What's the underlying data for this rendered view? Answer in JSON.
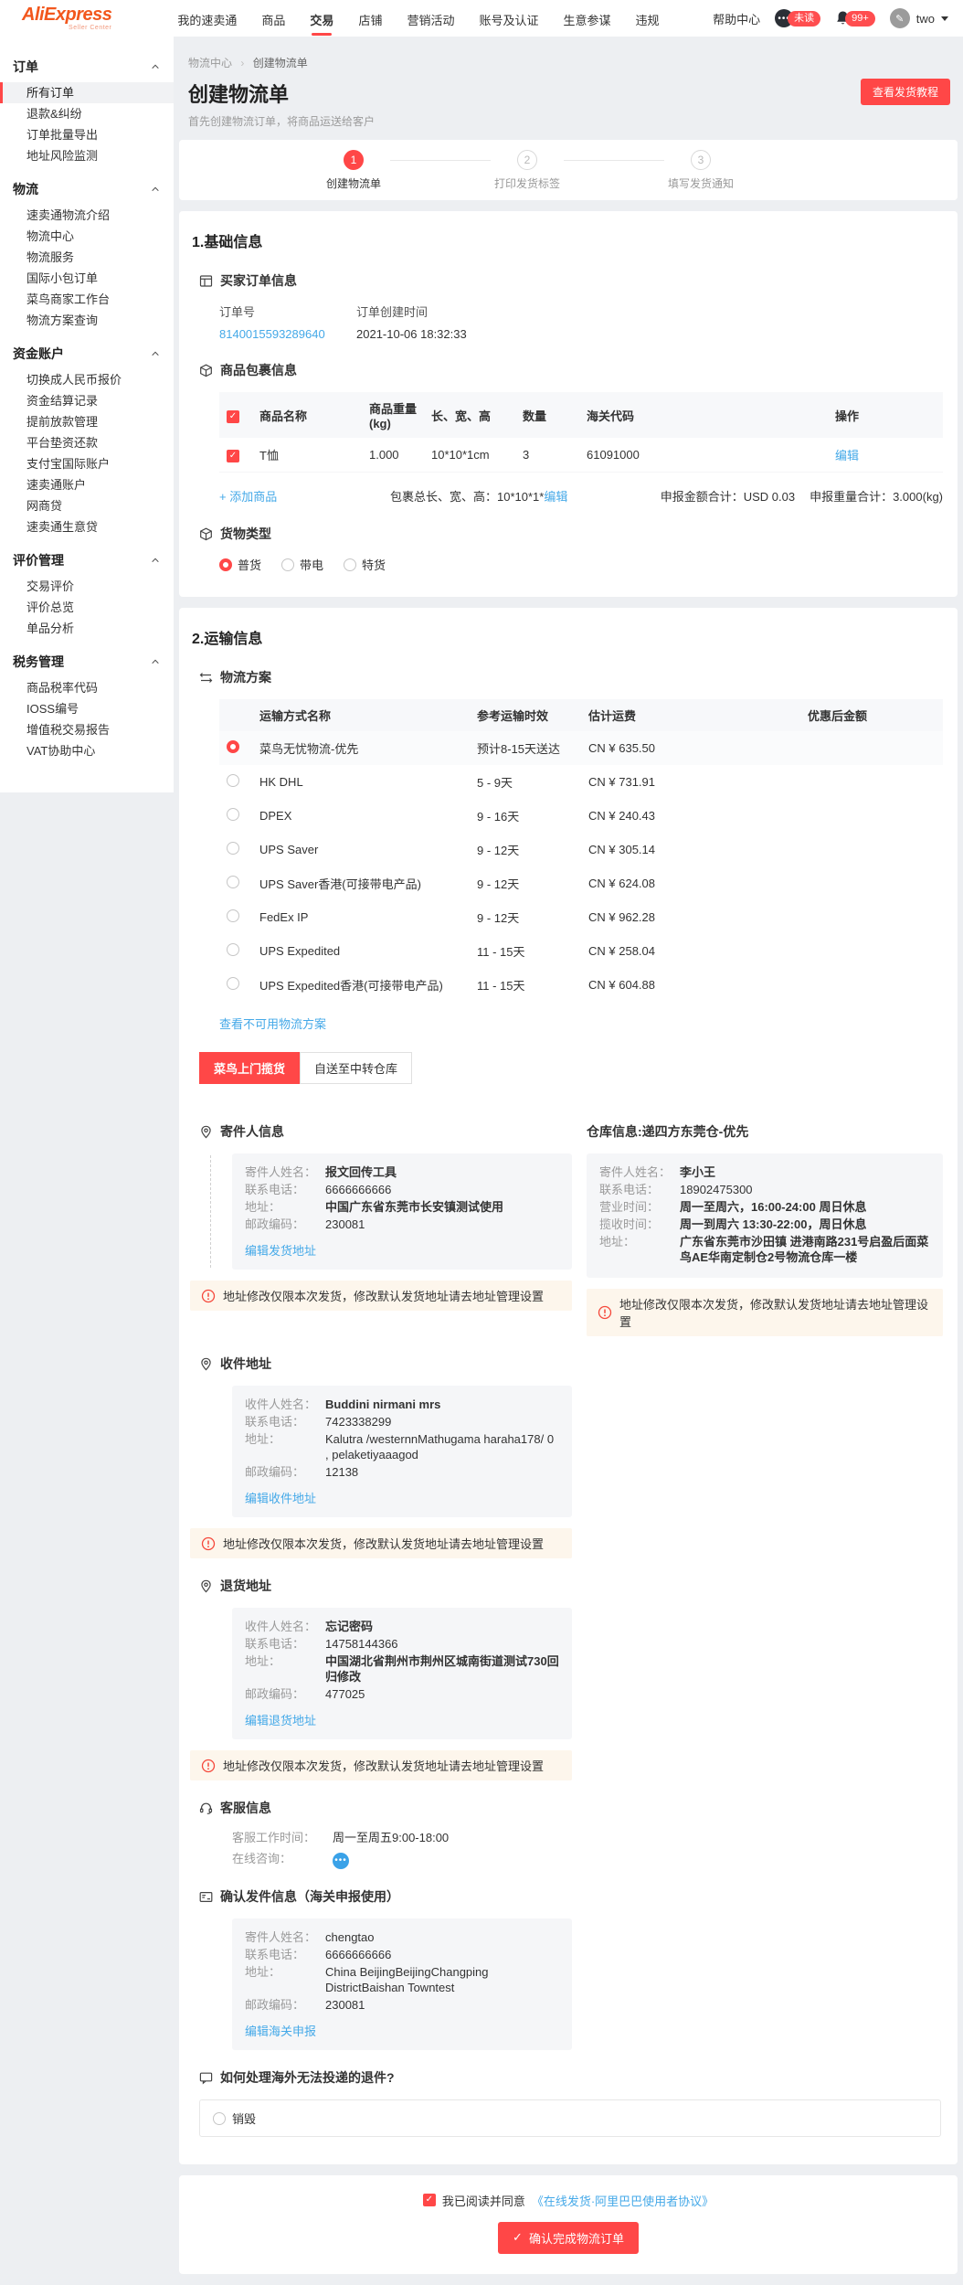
{
  "navbar": {
    "brand": "AliExpress",
    "brand_sub": "Seller Center",
    "menu": [
      "我的速卖通",
      "商品",
      "交易",
      "店铺",
      "营销活动",
      "账号及认证",
      "生意参谋",
      "违规"
    ],
    "help": "帮助中心",
    "unread_badge": "未读",
    "bell_badge": "99+",
    "username": "two"
  },
  "sidebar": {
    "sections": [
      {
        "title": "订单",
        "items": [
          "所有订单",
          "退款&纠纷",
          "订单批量导出",
          "地址风险监测"
        ]
      },
      {
        "title": "物流",
        "items": [
          "速卖通物流介绍",
          "物流中心",
          "物流服务",
          "国际小包订单",
          "菜鸟商家工作台",
          "物流方案查询"
        ]
      },
      {
        "title": "资金账户",
        "items": [
          "切换成人民币报价",
          "资金结算记录",
          "提前放款管理",
          "平台垫资还款",
          "支付宝国际账户",
          "速卖通账户",
          "网商贷",
          "速卖通生意贷"
        ]
      },
      {
        "title": "评价管理",
        "items": [
          "交易评价",
          "评价总览",
          "单品分析"
        ]
      },
      {
        "title": "税务管理",
        "items": [
          "商品税率代码",
          "IOSS编号",
          "增值税交易报告",
          "VAT协助中心"
        ]
      }
    ]
  },
  "page": {
    "breadcrumb_home": "物流中心",
    "breadcrumb_sep": "›",
    "breadcrumb_current": "创建物流单",
    "title": "创建物流单",
    "subtitle": "首先创建物流订单，将商品运送给客户",
    "tutorial_button": "查看发货教程"
  },
  "steps": [
    {
      "num": "1",
      "label": "创建物流单"
    },
    {
      "num": "2",
      "label": "打印发货标签"
    },
    {
      "num": "3",
      "label": "填写发货通知"
    }
  ],
  "basic": {
    "title": "1.基础信息",
    "order": {
      "title": "买家订单信息",
      "no_label": "订单号",
      "no": "8140015593289640",
      "time_label": "订单创建时间",
      "time": "2021-10-06 18:32:33"
    },
    "package": {
      "title": "商品包裹信息",
      "headers": [
        "商品名称",
        "商品重量(kg)",
        "长、宽、高",
        "数量",
        "海关代码",
        "操作"
      ],
      "row": {
        "name": "T恤",
        "weight": "1.000",
        "dims": "10*10*1cm",
        "qty": "3",
        "hs": "61091000",
        "action": "编辑"
      },
      "add": "+ 添加商品",
      "dims_label": "包裹总长、宽、高：10*10*1*",
      "dims_edit": "编辑",
      "amount_total": "申报金额合计：USD 0.03",
      "weight_total": "申报重量合计：3.000(kg)"
    },
    "cargo": {
      "title": "货物类型",
      "options": [
        "普货",
        "带电",
        "特货"
      ]
    }
  },
  "shipping": {
    "title": "2.运输信息",
    "plan_title": "物流方案",
    "headers": [
      "运输方式名称",
      "参考运输时效",
      "估计运费",
      "优惠后金额"
    ],
    "rows": [
      {
        "name": "菜鸟无忧物流-优先",
        "time": "预计8-15天送达",
        "fee": "CN ¥ 635.50"
      },
      {
        "name": "HK DHL",
        "time": "5 - 9天",
        "fee": "CN ¥ 731.91"
      },
      {
        "name": "DPEX",
        "time": "9 - 16天",
        "fee": "CN ¥ 240.43"
      },
      {
        "name": "UPS Saver",
        "time": "9 - 12天",
        "fee": "CN ¥ 305.14"
      },
      {
        "name": "UPS Saver香港(可接带电产品)",
        "time": "9 - 12天",
        "fee": "CN ¥ 624.08"
      },
      {
        "name": "FedEx IP",
        "time": "9 - 12天",
        "fee": "CN ¥ 962.28"
      },
      {
        "name": "UPS Expedited",
        "time": "11 - 15天",
        "fee": "CN ¥ 258.04"
      },
      {
        "name": "UPS Expedited香港(可接带电产品)",
        "time": "11 - 15天",
        "fee": "CN ¥ 604.88"
      }
    ],
    "more_link": "查看不可用物流方案",
    "tabs": [
      "菜鸟上门揽货",
      "自送至中转仓库"
    ]
  },
  "warning_text": "地址修改仅限本次发货，修改默认发货地址请去地址管理设置",
  "sender": {
    "title": "寄件人信息",
    "fields": [
      {
        "label": "寄件人姓名：",
        "value": "报文回传工具"
      },
      {
        "label": "联系电话：",
        "value": "6666666666"
      },
      {
        "label": "地址：",
        "value": "中国广东省东莞市长安镇测试使用"
      },
      {
        "label": "邮政编码：",
        "value": "230081"
      }
    ],
    "edit": "编辑发货地址"
  },
  "warehouse": {
    "title": "仓库信息:递四方东莞仓-优先",
    "fields": [
      {
        "label": "寄件人姓名：",
        "value": "李小王"
      },
      {
        "label": "联系电话：",
        "value": "18902475300"
      },
      {
        "label": "营业时间：",
        "value": "周一至周六，16:00-24:00 周日休息"
      },
      {
        "label": "揽收时间：",
        "value": "周一到周六 13:30-22:00，周日休息"
      },
      {
        "label": "地址：",
        "value": "广东省东莞市沙田镇 进港南路231号启盈后面菜鸟AE华南定制仓2号物流仓库一楼"
      }
    ]
  },
  "receiver": {
    "title": "收件地址",
    "fields": [
      {
        "label": "收件人姓名：",
        "value": "Buddini nirmani mrs"
      },
      {
        "label": "联系电话：",
        "value": "7423338299"
      },
      {
        "label": "地址：",
        "value": "Kalutra /westernnMathugama haraha178/ 0 , pelaketiyaaagod"
      },
      {
        "label": "邮政编码：",
        "value": "12138"
      }
    ],
    "edit": "编辑收件地址"
  },
  "return_addr": {
    "title": "退货地址",
    "fields": [
      {
        "label": "收件人姓名：",
        "value": "忘记密码"
      },
      {
        "label": "联系电话：",
        "value": "14758144366"
      },
      {
        "label": "地址：",
        "value": "中国湖北省荆州市荆州区城南街道测试730回归修改"
      },
      {
        "label": "邮政编码：",
        "value": "477025"
      }
    ],
    "edit": "编辑退货地址"
  },
  "service": {
    "title": "客服信息",
    "hours_label": "客服工作时间：",
    "hours": "周一至周五9:00-18:00",
    "online_label": "在线咨询："
  },
  "customs": {
    "title": "确认发件信息（海关申报使用）",
    "fields": [
      {
        "label": "寄件人姓名：",
        "value": "chengtao"
      },
      {
        "label": "联系电话：",
        "value": "6666666666"
      },
      {
        "label": "地址：",
        "value": "China BeijingBeijingChangping DistrictBaishan Towntest"
      },
      {
        "label": "邮政编码：",
        "value": "230081"
      }
    ],
    "edit": "编辑海关申报"
  },
  "undeliverable": {
    "title": "如何处理海外无法投递的退件?",
    "option": "销毁"
  },
  "footer": {
    "agree": "我已阅读并同意",
    "agreement": "《在线发货·阿里巴巴使用者协议》",
    "confirm": "确认完成物流订单",
    "confirm_check": "✓"
  }
}
